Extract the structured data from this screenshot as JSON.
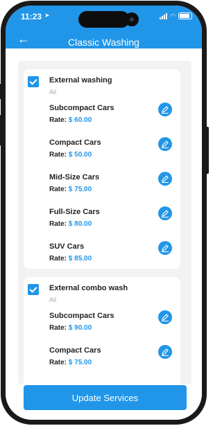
{
  "status": {
    "time": "11:23"
  },
  "header": {
    "title": "Classic Washing",
    "back_icon": "back-arrow-icon"
  },
  "groups": [
    {
      "title": "External washing",
      "subtitle": "All",
      "checked": true,
      "items": [
        {
          "name": "Subcompact Cars",
          "rate_label": "Rate:",
          "rate": "$ 60.00"
        },
        {
          "name": "Compact Cars",
          "rate_label": "Rate:",
          "rate": "$ 50.00"
        },
        {
          "name": "Mid-Size Cars",
          "rate_label": "Rate:",
          "rate": "$ 75.00"
        },
        {
          "name": "Full-Size Cars",
          "rate_label": "Rate:",
          "rate": "$ 80.00"
        },
        {
          "name": "SUV Cars",
          "rate_label": "Rate:",
          "rate": "$ 85.00"
        }
      ]
    },
    {
      "title": "External combo wash",
      "subtitle": "All",
      "checked": true,
      "items": [
        {
          "name": "Subcompact Cars",
          "rate_label": "Rate:",
          "rate": "$ 90.00"
        },
        {
          "name": "Compact Cars",
          "rate_label": "Rate:",
          "rate": "$ 75.00"
        }
      ]
    }
  ],
  "footer": {
    "update_label": "Update Services"
  },
  "colors": {
    "accent": "#2196e8",
    "background": "#f2f2f2"
  }
}
